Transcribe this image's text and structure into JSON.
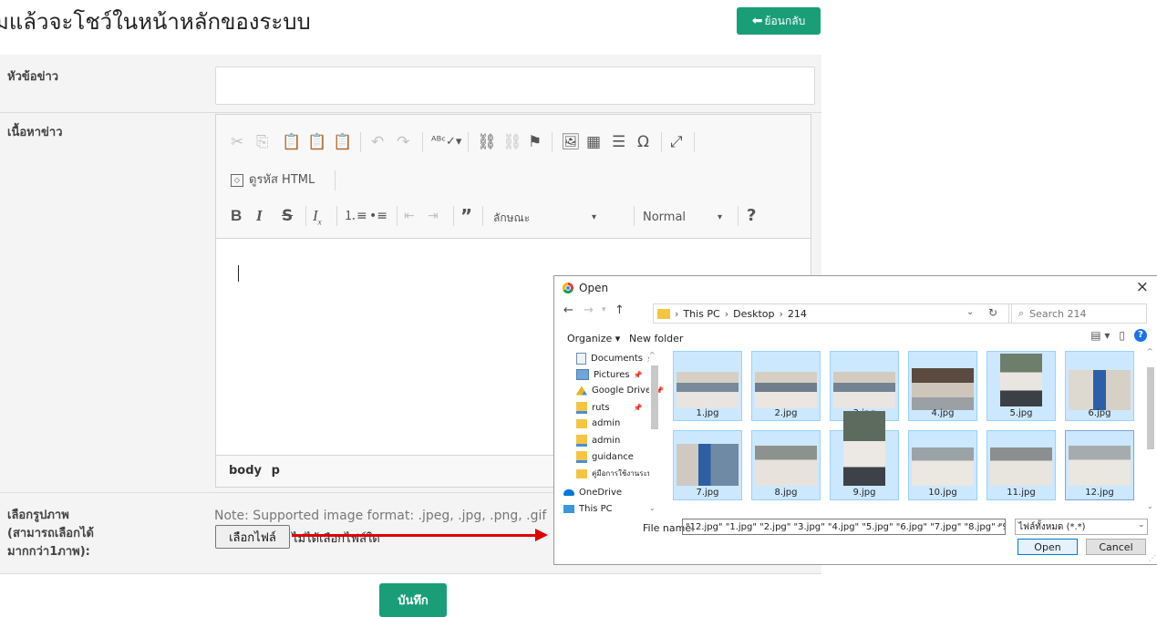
{
  "page": {
    "heading_fragment": "มแล้วจะโชว์ในหน้าหลักของระบบ",
    "back_button": "ย้อนกลับ",
    "save_button": "บันทึก"
  },
  "form": {
    "title_label": "หัวข้อข่าว",
    "title_value": "",
    "content_label": "เนื้อหาข่าว",
    "image_label_line1": "เลือกรูปภาพ",
    "image_label_line2": "(สามารถเลือกได้",
    "image_label_line3": "มากกว่า1ภาพ):",
    "image_note": "Note: Supported image format: .jpeg, .jpg, .png, .gif",
    "choose_file_button": "เลือกไฟล์",
    "no_file_text": "ไม่ได้เลือกไฟล์ใด"
  },
  "editor": {
    "source_button": "ดูรหัส HTML",
    "styles_dropdown": "ลักษณะ",
    "format_dropdown": "Normal",
    "help_button": "?",
    "statusbar_path": [
      "body",
      "p"
    ],
    "content": ""
  },
  "dialog": {
    "title": "Open",
    "close_glyph": "×",
    "breadcrumb": [
      "This PC",
      "Desktop",
      "214"
    ],
    "search_placeholder": "Search 214",
    "organize_label": "Organize ▾",
    "new_folder_label": "New folder",
    "nav_items": [
      {
        "label": "Documents",
        "icon": "document-icon",
        "pinned": true
      },
      {
        "label": "Pictures",
        "icon": "picture-folder-icon",
        "pinned": true
      },
      {
        "label": "Google Drive",
        "icon": "google-drive-icon",
        "pinned": true
      },
      {
        "label": "ruts",
        "icon": "network-folder-icon",
        "pinned": true
      },
      {
        "label": "admin",
        "icon": "folder-icon",
        "pinned": false
      },
      {
        "label": "admin",
        "icon": "network-folder-icon",
        "pinned": false
      },
      {
        "label": "guidance",
        "icon": "network-folder-icon",
        "pinned": false
      },
      {
        "label": "คู่มือการใช้งานระบบ",
        "icon": "folder-icon",
        "pinned": false
      },
      {
        "label": "OneDrive",
        "icon": "onedrive-icon",
        "pinned": false
      },
      {
        "label": "This PC",
        "icon": "pc-icon",
        "pinned": false
      }
    ],
    "files": [
      "1.jpg",
      "2.jpg",
      "3.jpg",
      "4.jpg",
      "5.jpg",
      "6.jpg",
      "7.jpg",
      "8.jpg",
      "9.jpg",
      "10.jpg",
      "11.jpg",
      "12.jpg"
    ],
    "file_name_label": "File name:",
    "file_name_value": "\"12.jpg\" \"1.jpg\" \"2.jpg\" \"3.jpg\" \"4.jpg\" \"5.jpg\" \"6.jpg\" \"7.jpg\" \"8.jpg\" \"9.jpg\" \"10.jpg\" \"1",
    "file_type_value": "ไฟล์ทั้งหมด (*.*)",
    "open_button": "Open",
    "cancel_button": "Cancel"
  },
  "colors": {
    "accent_green": "#1a9e78",
    "annotation_arrow": "#e00000",
    "selection_blue": "#cce8ff"
  }
}
